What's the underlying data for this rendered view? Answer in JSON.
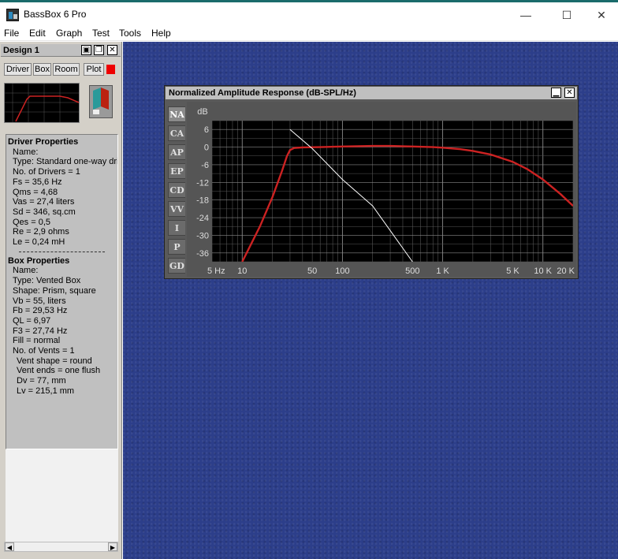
{
  "window": {
    "title": "BassBox 6 Pro",
    "min_glyph": "—",
    "max_glyph": "☐",
    "close_glyph": "✕"
  },
  "menu": [
    "File",
    "Edit",
    "Graph",
    "Test",
    "Tools",
    "Help"
  ],
  "design_panel": {
    "title": "Design 1",
    "tabs": [
      "Driver",
      "Box",
      "Room",
      "Plot"
    ],
    "driver_title": "Driver Properties",
    "driver_props": [
      "Name:",
      "Type: Standard one-way driv",
      "No. of Drivers = 1",
      "Fs =  35,6 Hz",
      "Qms =  4,68",
      "Vas =  27,4 liters",
      "Sd =  346, sq.cm",
      "Qes =  0,5",
      "Re =  2,9 ohms",
      "Le =  0,24 mH"
    ],
    "box_title": "Box Properties",
    "box_props": [
      "Name:",
      "Type: Vented Box",
      "Shape: Prism, square",
      "Vb =  55, liters",
      "Fb =  29,53 Hz",
      "QL =  6,97",
      "F3 =  27,74 Hz",
      "Fill = normal",
      "No. of Vents = 1",
      "  Vent shape = round",
      "  Vent ends = one flush",
      "  Dv =  77, mm",
      "  Lv =  215,1 mm"
    ]
  },
  "graph_window": {
    "title": "Normalized Amplitude Response (dB-SPL/Hz)",
    "side_tabs": [
      "NA",
      "CA",
      "AP",
      "EP",
      "CD",
      "VV",
      "I",
      "P",
      "GD"
    ],
    "active_tab": "NA"
  },
  "chart_data": {
    "type": "line",
    "title": "Normalized Amplitude Response (dB-SPL/Hz)",
    "ylabel": "dB",
    "xscale": "log",
    "xlim": [
      5,
      20000
    ],
    "ylim": [
      -39,
      9
    ],
    "y_ticks": [
      6,
      0,
      -6,
      -12,
      -18,
      -24,
      -30,
      -36
    ],
    "x_tick_labels": [
      {
        "v": 5,
        "t": "5 Hz"
      },
      {
        "v": 10,
        "t": "10"
      },
      {
        "v": 50,
        "t": "50"
      },
      {
        "v": 100,
        "t": "100"
      },
      {
        "v": 500,
        "t": "500"
      },
      {
        "v": 1000,
        "t": "1 K"
      },
      {
        "v": 5000,
        "t": "5 K"
      },
      {
        "v": 10000,
        "t": "10 K"
      },
      {
        "v": 20000,
        "t": "20 K"
      }
    ],
    "grid": true,
    "series": [
      {
        "color": "#cc2222",
        "x": [
          10,
          15,
          20,
          25,
          28,
          30,
          33,
          40,
          60,
          100,
          200,
          300,
          500,
          800,
          1000,
          1500,
          2000,
          3000,
          5000,
          7000,
          10000,
          15000,
          20000
        ],
        "y": [
          -39,
          -27,
          -17,
          -8,
          -3,
          -1,
          -0.3,
          -0.1,
          0,
          0.2,
          0.4,
          0.4,
          0.2,
          0,
          -0.2,
          -0.7,
          -1.3,
          -2.5,
          -5,
          -7.5,
          -11,
          -16,
          -20
        ]
      },
      {
        "color": "#ffffff",
        "x": [
          30,
          50,
          100,
          200,
          500
        ],
        "y": [
          6,
          -0.5,
          -11,
          -20,
          -39
        ]
      }
    ]
  }
}
